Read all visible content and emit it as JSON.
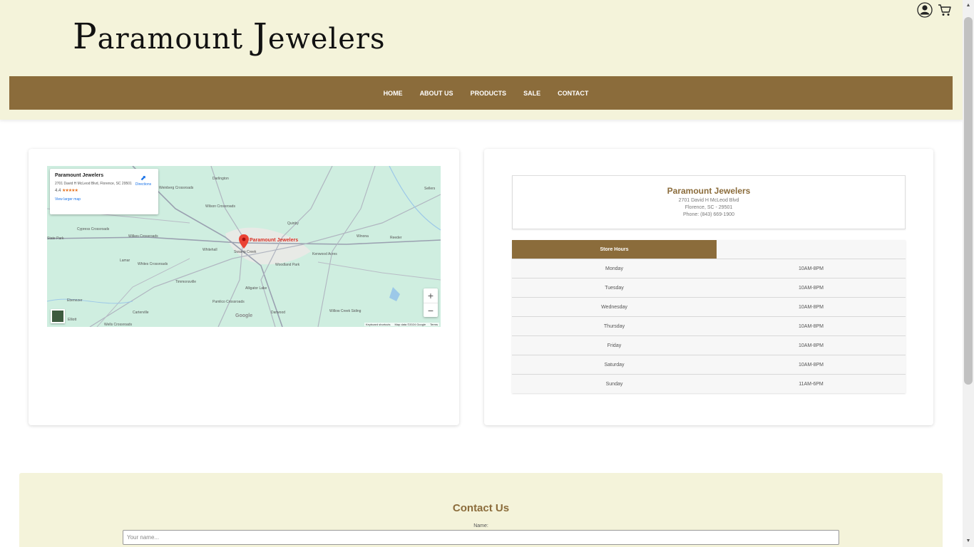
{
  "header": {
    "logo_first": "P",
    "logo_rest1": "aramount ",
    "logo_second": "J",
    "logo_rest2": "ewelers",
    "icons": [
      "user-icon",
      "cart-icon"
    ]
  },
  "nav": {
    "items": [
      "HOME",
      "ABOUT US",
      "PRODUCTS",
      "SALE",
      "CONTACT"
    ]
  },
  "map": {
    "place_name": "Paramount Jewelers",
    "place_address": "2701 David H McLeod Blvd, Florence, SC 29501",
    "rating": "4.4",
    "stars": "★★★★★",
    "view_larger": "View larger map",
    "directions": "Directions",
    "pin_label": "Paramount Jewelers",
    "zoom_in": "+",
    "zoom_out": "−",
    "google": "Google",
    "footer": [
      "Keyboard shortcuts",
      "Map data ©2024 Google",
      "Terms"
    ],
    "labels": [
      "Darlington",
      "Weinberg Crossroads",
      "Sellers",
      "Cypress Crossroads",
      "Wilson Crossroads",
      "Quinby",
      "Winona",
      "Reeder",
      "State Park",
      "Wilkes Crossroads",
      "Whitehall",
      "Kenwood Acres",
      "Lamar",
      "Whites Crossroads",
      "Woodland Park",
      "Timmonsville",
      "Alligator Lake",
      "Pamlico Crossroads",
      "Ebenezer",
      "Carterville",
      "Darwood",
      "Willow Creek Siding",
      "Elliott",
      "Wells Crossroads",
      "Swamp Creek"
    ]
  },
  "store": {
    "name": "Paramount Jewelers",
    "address": "2701 David H McLeod Blvd",
    "city": "Florence, SC - 29501",
    "phone": "Phone: (843) 669-1900"
  },
  "hours": {
    "title": "Store Hours",
    "rows": [
      {
        "day": "Monday",
        "time": "10AM-8PM"
      },
      {
        "day": "Tuesday",
        "time": "10AM-8PM"
      },
      {
        "day": "Wednesday",
        "time": "10AM-8PM"
      },
      {
        "day": "Thursday",
        "time": "10AM-8PM"
      },
      {
        "day": "Friday",
        "time": "10AM-8PM"
      },
      {
        "day": "Saturday",
        "time": "10AM-8PM"
      },
      {
        "day": "Sunday",
        "time": "11AM-6PM"
      }
    ]
  },
  "contact": {
    "title": "Contact Us",
    "name_label": "Name:",
    "name_placeholder": "Your name...",
    "name_value": ""
  },
  "colors": {
    "brand": "#8b6c3b",
    "header_bg": "#f4f3da",
    "map_water": "#cfeee0"
  }
}
